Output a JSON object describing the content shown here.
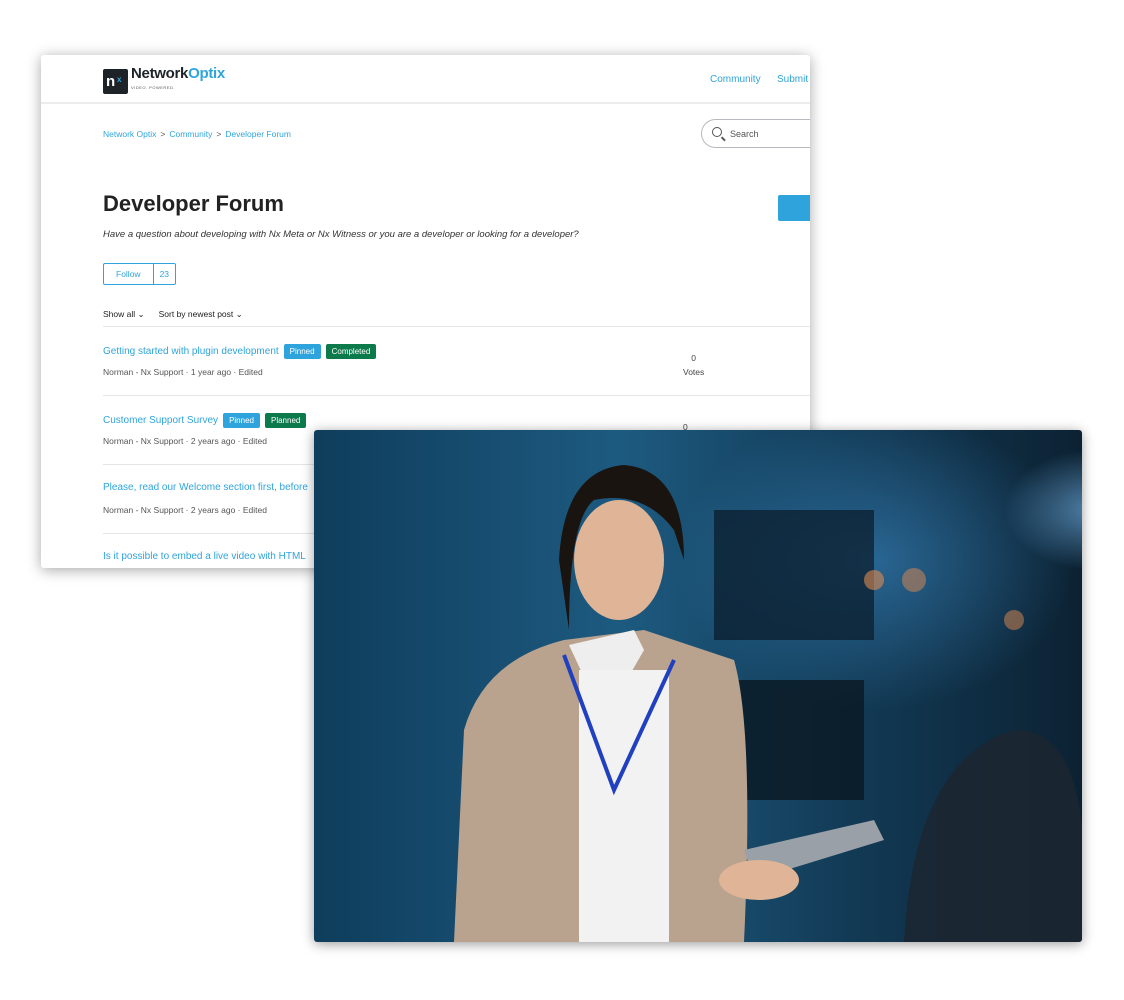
{
  "header": {
    "logo_text_1": "Network",
    "logo_text_2": "Optix",
    "logo_tagline": "VIDEO. POWERED.",
    "nav": [
      "Community",
      "Submit"
    ]
  },
  "breadcrumb": [
    "Network Optix",
    "Community",
    "Developer Forum"
  ],
  "search": {
    "placeholder": "Search"
  },
  "page": {
    "title": "Developer Forum",
    "description": "Have a question about developing with Nx Meta or Nx Witness or you are a developer or looking for a developer?",
    "follow_label": "Follow",
    "follow_count": "23"
  },
  "filters": {
    "show": "Show all ⌄",
    "sort": "Sort by newest post ⌄"
  },
  "posts": [
    {
      "title": "Getting started with plugin development",
      "badges": [
        "Pinned",
        "Completed"
      ],
      "author": "Norman - Nx Support",
      "time": "1 year ago",
      "edited": "Edited",
      "votes": "0",
      "votes_label": "Votes"
    },
    {
      "title": "Customer Support Survey",
      "badges": [
        "Pinned",
        "Planned"
      ],
      "author": "Norman - Nx Support",
      "time": "2 years ago",
      "edited": "Edited",
      "votes": "0"
    },
    {
      "title": "Please, read our Welcome section first, before",
      "author": "Norman - Nx Support",
      "time": "2 years ago",
      "edited": "Edited"
    },
    {
      "title": "Is it possible to embed a live video with HTML"
    }
  ],
  "colors": {
    "accent": "#2fa4dc",
    "completed": "#0c7a4a",
    "pinned": "#2fa4dc"
  }
}
